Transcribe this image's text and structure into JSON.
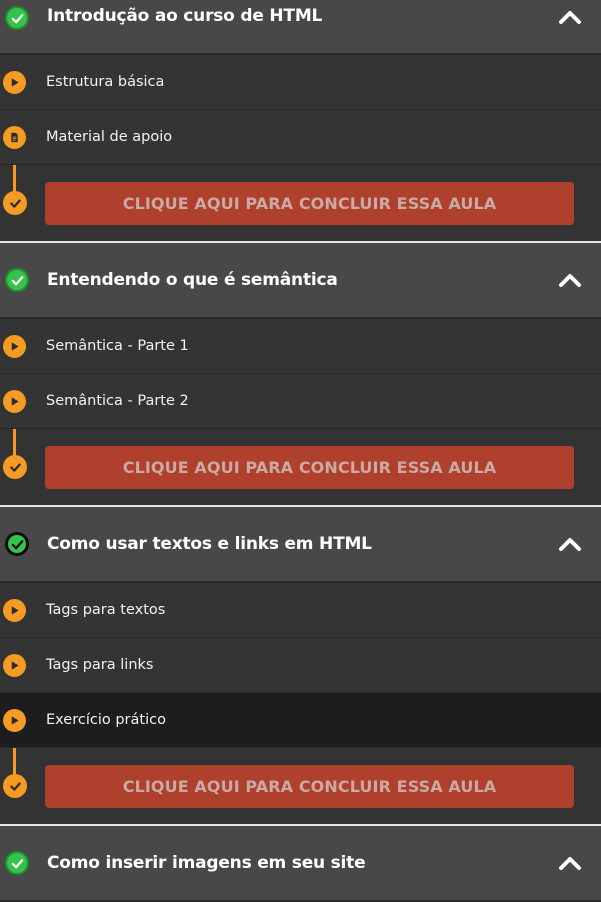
{
  "modules": [
    {
      "title": "Introdução ao curso de HTML",
      "lessons": [
        {
          "label": "Estrutura básica",
          "icon": "play-icon"
        },
        {
          "label": "Material de apoio",
          "icon": "document-icon"
        }
      ],
      "complete_label": "CLIQUE AQUI PARA CONCLUIR ESSA AULA"
    },
    {
      "title": "Entendendo o que é semântica",
      "lessons": [
        {
          "label": "Semântica - Parte 1",
          "icon": "play-icon"
        },
        {
          "label": "Semântica - Parte 2",
          "icon": "play-icon"
        }
      ],
      "complete_label": "CLIQUE AQUI PARA CONCLUIR ESSA AULA"
    },
    {
      "title": "Como usar textos e links em HTML",
      "lessons": [
        {
          "label": "Tags para textos",
          "icon": "play-icon"
        },
        {
          "label": "Tags para links",
          "icon": "play-icon"
        },
        {
          "label": "Exercício prático",
          "icon": "play-icon",
          "active": true
        }
      ],
      "complete_label": "CLIQUE AQUI PARA CONCLUIR ESSA AULA"
    },
    {
      "title": "Como inserir imagens em seu site",
      "lessons": [],
      "complete_label": ""
    }
  ],
  "colors": {
    "accent": "#f59a23",
    "complete_button": "#b0402e",
    "check_green": "#36c24b",
    "header_bg": "#484848",
    "lesson_bg": "#343434",
    "active_lesson_bg": "#1d1d1d"
  }
}
